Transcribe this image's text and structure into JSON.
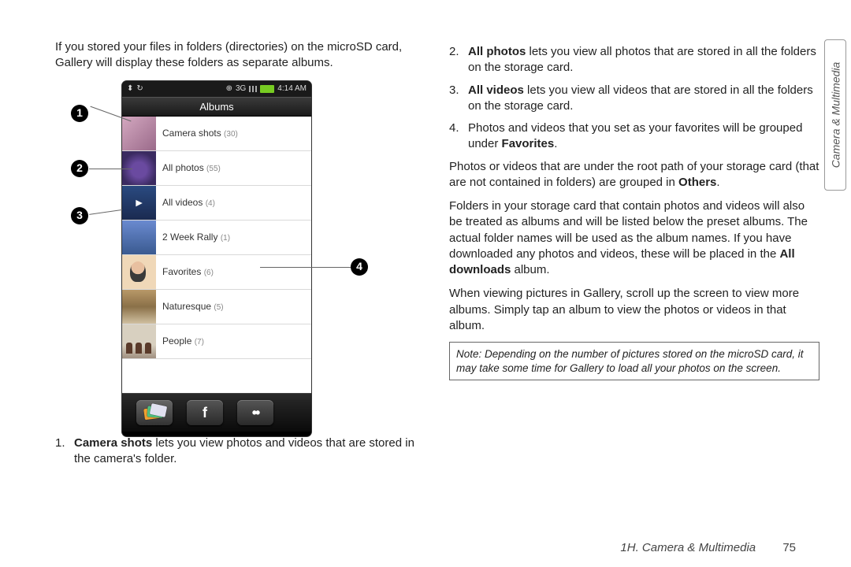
{
  "left": {
    "intro": "If you stored your files in folders (directories) on the microSD card, Gallery will display these folders as separate albums.",
    "phone": {
      "status_time": "4:14 AM",
      "status_net": "3G",
      "title": "Albums",
      "albums": [
        {
          "name": "Camera shots",
          "count": "(30)"
        },
        {
          "name": "All photos",
          "count": "(55)"
        },
        {
          "name": "All videos",
          "count": "(4)"
        },
        {
          "name": "2 Week Rally",
          "count": "(1)"
        },
        {
          "name": "Favorites",
          "count": "(6)"
        },
        {
          "name": "Naturesque",
          "count": "(5)"
        },
        {
          "name": "People",
          "count": "(7)"
        }
      ],
      "bottom_fb_label": "f"
    },
    "callouts": {
      "c1": "1",
      "c2": "2",
      "c3": "3",
      "c4": "4"
    },
    "item1_num": "1.",
    "item1_lead": "Camera shots",
    "item1_rest": " lets you view photos and videos that are stored in the camera's folder."
  },
  "right": {
    "item2_num": "2.",
    "item2_lead": "All photos",
    "item2_rest": " lets you view all photos that are stored in all the folders on the storage card.",
    "item3_num": "3.",
    "item3_lead": "All videos",
    "item3_rest": " lets you view all videos that are stored in all the folders on the storage card.",
    "item4_num": "4.",
    "item4_text_a": "Photos and videos that you set as your favorites will be grouped under ",
    "item4_bold": "Favorites",
    "item4_text_b": ".",
    "para_others_a": "Photos or videos that are under the root path of your storage card (that are not contained in folders) are grouped in ",
    "para_others_bold": "Others",
    "para_others_b": ".",
    "para_downloads_a": "Folders in your storage card that contain photos and videos will also be treated as albums and will be listed below the preset albums. The actual folder names will be used as the album names. If you have downloaded any photos and videos, these will be placed in the ",
    "para_downloads_bold": "All downloads",
    "para_downloads_b": " album.",
    "para_scroll": "When viewing pictures in Gallery, scroll up the screen to view more albums. Simply tap an album to view the photos or videos in that album.",
    "note_label": "Note:",
    "note_text": "Depending on the number of pictures stored on the microSD card, it may take some time for Gallery to load all your photos on the screen."
  },
  "side_tab": "Camera & Multimedia",
  "footer_section": "1H. Camera & Multimedia",
  "footer_page": "75"
}
